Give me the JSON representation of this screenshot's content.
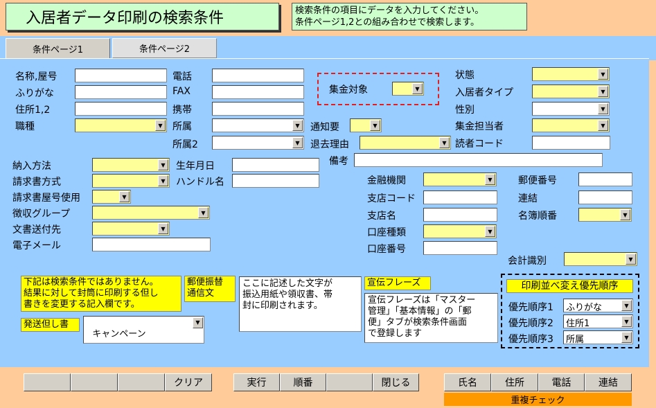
{
  "header": {
    "title": "入居者データ印刷の検索条件",
    "note_line1": "検索条件の項目にデータを入力してください。",
    "note_line2": "条件ページ1,2との組み合わせで検索します。"
  },
  "tabs": [
    "条件ページ1",
    "条件ページ2"
  ],
  "fields": {
    "name": "名称,屋号",
    "furigana": "ふりがな",
    "address": "住所1,2",
    "occupation": "職種",
    "phone": "電話",
    "fax": "FAX",
    "mobile": "携帯",
    "affiliation": "所属",
    "affiliation2": "所属2",
    "collect_target": "集金対象",
    "notice_required": "通知要",
    "leave_reason": "退去理由",
    "status": "状態",
    "resident_type": "入居者タイプ",
    "gender": "性別",
    "collector": "集金担当者",
    "reader_code": "読者コード",
    "payment_method": "納入方法",
    "invoice_method": "請求書方式",
    "invoice_house_no": "請求書屋号使用",
    "collection_group": "徴収グループ",
    "doc_destination": "文書送付先",
    "email": "電子メール",
    "birthdate": "生年月日",
    "handle_name": "ハンドル名",
    "remarks": "備考",
    "bank": "金融機関",
    "branch_code": "支店コード",
    "branch_name": "支店名",
    "account_type": "口座種類",
    "account_number": "口座番号",
    "postal_code": "郵便番号",
    "link": "連結",
    "roster_order": "名簿順番",
    "accounting_id": "会計識別"
  },
  "notes": {
    "condition_note": "下記は検索条件ではありません。\n結果に対して封筒に印刷する但し\n書きを変更する記入欄です。",
    "send_notice_label": "発送但し書",
    "send_notice_value": "キャンペーン",
    "postal_transfer_label": "郵便振替\n通信文",
    "postal_transfer_text": "ここに記述した文字が\n振込用紙や領収書、帯\n封に印刷されます。",
    "ad_phrase_label": "宣伝フレーズ",
    "ad_phrase_text": "宣伝フレーズは「マスター\n管理」「基本情報」の「郵\n便」タブが検索条件画面\nで登録します"
  },
  "priority": {
    "title": "印刷並べ変え優先順序",
    "items": [
      {
        "label": "優先順序1",
        "value": "ふりがな"
      },
      {
        "label": "優先順序2",
        "value": "住所1"
      },
      {
        "label": "優先順序3",
        "value": "所属"
      }
    ]
  },
  "footer": {
    "clear": "クリア",
    "run": "実行",
    "order": "順番",
    "close": "閉じる",
    "sort_name": "氏名",
    "sort_address": "住所",
    "sort_phone": "電話",
    "sort_link": "連結",
    "duplicate_check": "重複チェック"
  }
}
